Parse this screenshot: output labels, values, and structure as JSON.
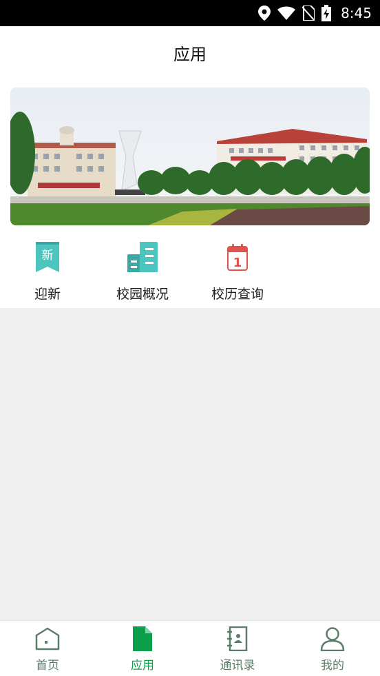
{
  "status_bar": {
    "time": "8:45",
    "icons": [
      "location-icon",
      "wifi-icon",
      "no-sim-icon",
      "battery-charging-icon"
    ]
  },
  "header": {
    "title": "应用"
  },
  "banner": {
    "image": "campus-photo"
  },
  "apps": [
    {
      "label": "迎新",
      "icon": "new-badge-icon",
      "icon_text": "新"
    },
    {
      "label": "校园概况",
      "icon": "building-icon"
    },
    {
      "label": "校历查询",
      "icon": "calendar-icon",
      "icon_text": "1"
    }
  ],
  "tabs": [
    {
      "label": "首页",
      "icon": "home-icon",
      "active": false
    },
    {
      "label": "应用",
      "icon": "document-icon",
      "active": true
    },
    {
      "label": "通讯录",
      "icon": "contacts-book-icon",
      "active": false
    },
    {
      "label": "我的",
      "icon": "person-icon",
      "active": false
    }
  ],
  "colors": {
    "accent": "#0ca04a",
    "teal": "#4cc5be",
    "calendar_red": "#e0544f",
    "tab_inactive": "#5a7d69"
  }
}
